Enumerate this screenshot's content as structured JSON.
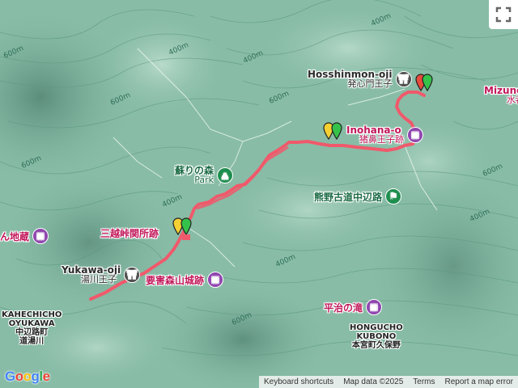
{
  "colors": {
    "route": "#f0596b",
    "terrain": "#7fb7a0",
    "poi_purple": "#8e44ad",
    "poi_green": "#1e8e4e"
  },
  "labels": {
    "hosshinmon": {
      "en": "Hosshinmon-oji",
      "jp": "発心門王子"
    },
    "mizunomi": {
      "en": "Mizunom",
      "jp": "水呑王"
    },
    "inohana": {
      "en": "Inohana-o",
      "jp": "猪鼻王子跡"
    },
    "soseki": {
      "jp": "蘇りの森",
      "en": "Park"
    },
    "kumano": {
      "jp": "熊野古道中辺路"
    },
    "mikoshi": {
      "jp": "三越峠関所跡"
    },
    "yukawa": {
      "en": "Yukawa-oji",
      "jp": "湯川王子"
    },
    "yogai": {
      "jp": "要害森山城跡"
    },
    "jizo": {
      "jp": "ん地蔵"
    },
    "heiji": {
      "jp": "平治の滝"
    }
  },
  "places": {
    "nakahechi": {
      "lines": [
        "KAHECHICHO",
        "OYUKAWA",
        "中辺路町",
        "道湯川"
      ]
    },
    "hongu": {
      "lines": [
        "HONGUCHO",
        "KUBONO",
        "本宮町久保野"
      ]
    }
  },
  "elevations": [
    "600m",
    "400m",
    "600m",
    "400m",
    "600m",
    "400m",
    "600m",
    "400m",
    "400m",
    "400m",
    "600m",
    "600m"
  ],
  "attribution": {
    "shortcuts": "Keyboard shortcuts",
    "data": "Map data ©2025",
    "terms": "Terms",
    "report": "Report a map error"
  },
  "logo_icon": "google-logo"
}
